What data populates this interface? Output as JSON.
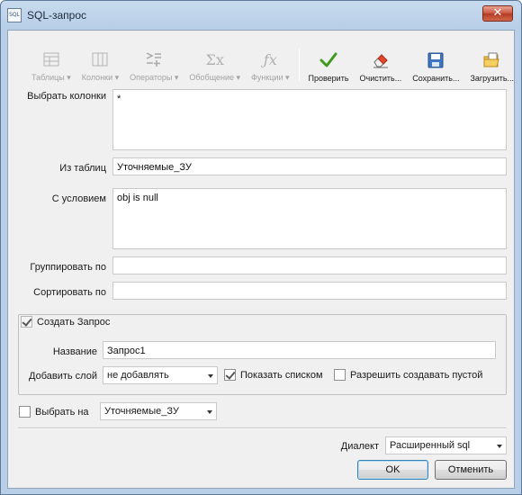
{
  "window": {
    "title": "SQL-запрос",
    "icon_text": "SQL",
    "close_glyph": "✕"
  },
  "toolbar": {
    "items": [
      {
        "label": "Таблицы ▾",
        "icon": "table-icon",
        "enabled": false
      },
      {
        "label": "Колонки ▾",
        "icon": "columns-icon",
        "enabled": false
      },
      {
        "label": "Операторы ▾",
        "icon": "operators-icon",
        "enabled": false
      },
      {
        "label": "Обобщение ▾",
        "icon": "sigma-icon",
        "enabled": false
      },
      {
        "label": "Функции ▾",
        "icon": "function-icon",
        "enabled": false
      },
      {
        "label": "Проверить",
        "icon": "check-icon",
        "enabled": true
      },
      {
        "label": "Очистить...",
        "icon": "eraser-icon",
        "enabled": true
      },
      {
        "label": "Сохранить...",
        "icon": "save-icon",
        "enabled": true
      },
      {
        "label": "Загрузить...",
        "icon": "load-icon",
        "enabled": true
      }
    ]
  },
  "form": {
    "select_columns": {
      "label": "Выбрать колонки",
      "value": "*"
    },
    "from_tables": {
      "label": "Из таблиц",
      "value": "Уточняемые_ЗУ"
    },
    "where": {
      "label": "С условием",
      "value": "obj is null"
    },
    "group_by": {
      "label": "Группировать по",
      "value": ""
    },
    "order_by": {
      "label": "Сортировать по",
      "value": ""
    }
  },
  "create_query": {
    "checkbox_label": "Создать Запрос",
    "checked": true,
    "name": {
      "label": "Название",
      "value": "Запрос1"
    },
    "add_layer": {
      "label": "Добавить слой",
      "value": "не добавлять"
    },
    "show_as_list": {
      "label": "Показать списком",
      "checked": true
    },
    "allow_empty": {
      "label": "Разрешить создавать пустой",
      "checked": false
    }
  },
  "select_on": {
    "label": "Выбрать на",
    "checked": false,
    "value": "Уточняемые_ЗУ"
  },
  "dialect": {
    "label": "Диалект",
    "value": "Расширенный sql"
  },
  "buttons": {
    "ok": "OK",
    "cancel": "Отменить"
  },
  "colors": {
    "accent_check": "#3f9a1f",
    "title_bar": "#b9cfe7",
    "close": "#c8553e"
  }
}
